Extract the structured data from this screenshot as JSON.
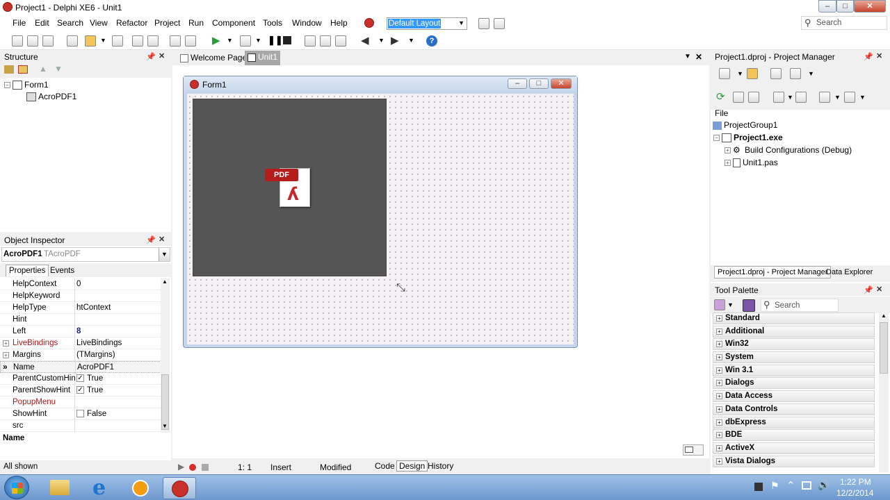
{
  "window": {
    "title": "Project1 - Delphi XE6 - Unit1"
  },
  "menu": [
    "File",
    "Edit",
    "Search",
    "View",
    "Refactor",
    "Project",
    "Run",
    "Component",
    "Tools",
    "Window",
    "Help"
  ],
  "layout_combo": "Default Layout",
  "search_placeholder": "Search",
  "structure": {
    "title": "Structure",
    "root": "Form1",
    "child": "AcroPDF1"
  },
  "editor_tabs": [
    "Welcome Page",
    "Unit1"
  ],
  "form": {
    "caption": "Form1",
    "pdf_label": "PDF"
  },
  "object_inspector": {
    "title": "Object Inspector",
    "selected_name": "AcroPDF1",
    "selected_type": "TAcroPDF",
    "tabs": [
      "Properties",
      "Events"
    ],
    "rows": [
      {
        "name": "HelpContext",
        "value": "0"
      },
      {
        "name": "HelpKeyword",
        "value": ""
      },
      {
        "name": "HelpType",
        "value": "htContext"
      },
      {
        "name": "Hint",
        "value": ""
      },
      {
        "name": "Left",
        "value": "8"
      },
      {
        "name": "LiveBindings",
        "value": "LiveBindings"
      },
      {
        "name": "Margins",
        "value": "(TMargins)"
      },
      {
        "name": "Name",
        "value": "AcroPDF1"
      },
      {
        "name": "ParentCustomHin",
        "value": "True"
      },
      {
        "name": "ParentShowHint",
        "value": "True"
      },
      {
        "name": "PopupMenu",
        "value": ""
      },
      {
        "name": "ShowHint",
        "value": "False"
      },
      {
        "name": "src",
        "value": ""
      }
    ],
    "description_label": "Name",
    "footer": "All shown"
  },
  "status": {
    "position": "1:  1",
    "mode": "Insert",
    "state": "Modified",
    "tabs": [
      "Code",
      "Design",
      "History"
    ]
  },
  "project_manager": {
    "title": "Project1.dproj - Project Manager",
    "file_label": "File",
    "group": "ProjectGroup1",
    "project": "Project1.exe",
    "build": "Build Configurations (Debug)",
    "unit": "Unit1.pas",
    "tabs": [
      "Project1.dproj - Project Manager",
      "Data Explorer"
    ]
  },
  "tool_palette": {
    "title": "Tool Palette",
    "search_placeholder": "Search",
    "categories": [
      "Standard",
      "Additional",
      "Win32",
      "System",
      "Win 3.1",
      "Dialogs",
      "Data Access",
      "Data Controls",
      "dbExpress",
      "BDE",
      "ActiveX",
      "Vista Dialogs"
    ]
  },
  "taskbar": {
    "time": "1:22 PM",
    "date": "12/2/2014"
  }
}
